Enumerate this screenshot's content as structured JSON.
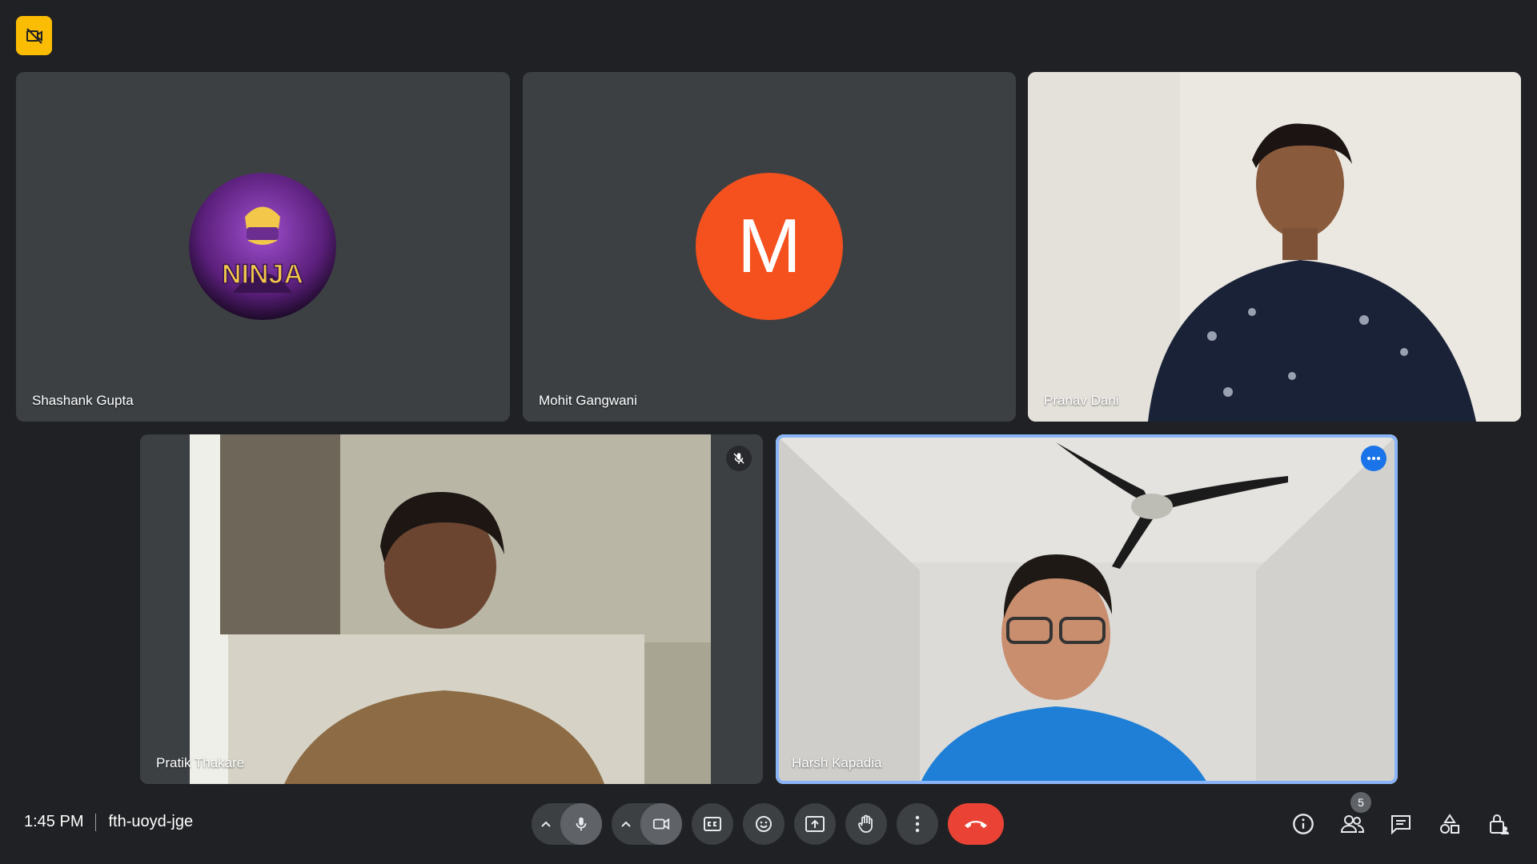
{
  "participants": [
    {
      "name": "Shashank Gupta",
      "avatar": "ninja-logo-avatar",
      "avatar_text": "NINJA"
    },
    {
      "name": "Mohit Gangwani",
      "avatar_letter": "M",
      "avatar_color": "#f4511e"
    },
    {
      "name": "Pranav Dani",
      "video": true
    },
    {
      "name": "Pratik Thakare",
      "video": true,
      "muted": true
    },
    {
      "name": "Harsh Kapadia",
      "video": true,
      "speaking": true
    }
  ],
  "meeting": {
    "time": "1:45 PM",
    "code": "fth-uoyd-jge"
  },
  "people_count": "5",
  "colors": {
    "accent": "#8ab4f8",
    "end_call": "#ea4335",
    "badge": "#fbbc04"
  }
}
